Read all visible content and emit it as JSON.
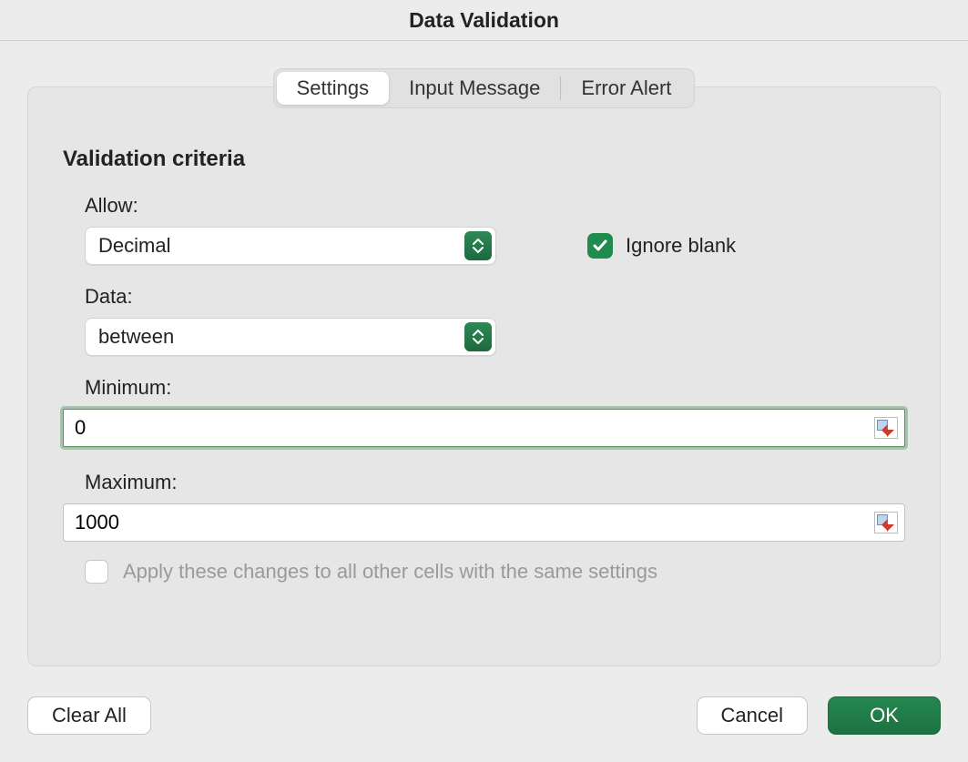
{
  "dialog": {
    "title": "Data Validation",
    "tabs": [
      {
        "label": "Settings",
        "active": true
      },
      {
        "label": "Input Message",
        "active": false
      },
      {
        "label": "Error Alert",
        "active": false
      }
    ]
  },
  "criteria": {
    "section_title": "Validation criteria",
    "allow_label": "Allow:",
    "allow_value": "Decimal",
    "data_label": "Data:",
    "data_value": "between",
    "minimum_label": "Minimum:",
    "minimum_value": "0",
    "maximum_label": "Maximum:",
    "maximum_value": "1000"
  },
  "options": {
    "ignore_blank_label": "Ignore blank",
    "ignore_blank_checked": true,
    "apply_all_label": "Apply these changes to all other cells with the same settings",
    "apply_all_checked": false,
    "apply_all_enabled": false
  },
  "buttons": {
    "clear_all": "Clear All",
    "cancel": "Cancel",
    "ok": "OK"
  }
}
